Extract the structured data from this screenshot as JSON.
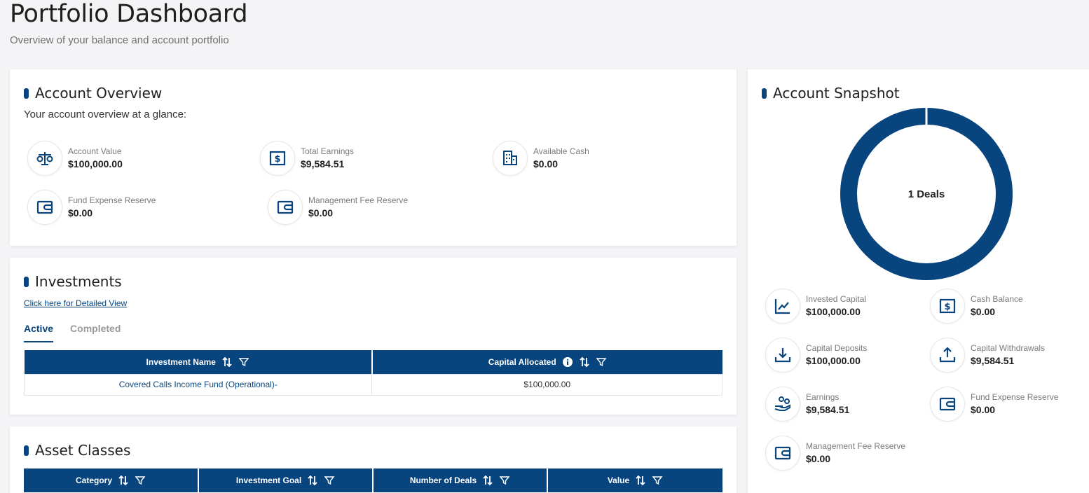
{
  "header": {
    "title": "Portfolio Dashboard",
    "subtitle": "Overview of your balance and account portfolio"
  },
  "overview": {
    "title": "Account Overview",
    "subtitle": "Your account overview at a glance:",
    "stats": [
      {
        "label": "Account Value",
        "value": "$100,000.00",
        "icon": "scale-icon"
      },
      {
        "label": "Total Earnings",
        "value": "$9,584.51",
        "icon": "dollar-bill-icon"
      },
      {
        "label": "Available Cash",
        "value": "$0.00",
        "icon": "building-icon"
      },
      {
        "label": "Fund Expense Reserve",
        "value": "$0.00",
        "icon": "wallet-icon"
      },
      {
        "label": "Management Fee Reserve",
        "value": "$0.00",
        "icon": "wallet-icon"
      }
    ]
  },
  "investments": {
    "title": "Investments",
    "detail_link": "Click here for Detailed View",
    "tabs": [
      {
        "label": "Active",
        "active": true
      },
      {
        "label": "Completed",
        "active": false
      }
    ],
    "columns": [
      "Investment Name",
      "Capital Allocated"
    ],
    "rows": [
      [
        "Covered Calls Income Fund (Operational)-",
        "$100,000.00"
      ]
    ]
  },
  "asset_classes": {
    "title": "Asset Classes",
    "columns": [
      "Category",
      "Investment Goal",
      "Number of Deals",
      "Value"
    ]
  },
  "snapshot": {
    "title": "Account Snapshot",
    "donut_label": "1 Deals",
    "donut_color": "#08457e",
    "stats": [
      {
        "label": "Invested Capital",
        "value": "$100,000.00",
        "icon": "line-chart-icon"
      },
      {
        "label": "Cash Balance",
        "value": "$0.00",
        "icon": "dollar-bill-icon"
      },
      {
        "label": "Capital Deposits",
        "value": "$100,000.00",
        "icon": "download-icon"
      },
      {
        "label": "Capital Withdrawals",
        "value": "$9,584.51",
        "icon": "upload-icon"
      },
      {
        "label": "Earnings",
        "value": "$9,584.51",
        "icon": "hand-coins-icon"
      },
      {
        "label": "Fund Expense Reserve",
        "value": "$0.00",
        "icon": "wallet-icon"
      },
      {
        "label": "Management Fee Reserve",
        "value": "$0.00",
        "icon": "wallet-icon"
      }
    ]
  },
  "theme": {
    "accent": "#08457e",
    "background": "#f4f4f6"
  }
}
